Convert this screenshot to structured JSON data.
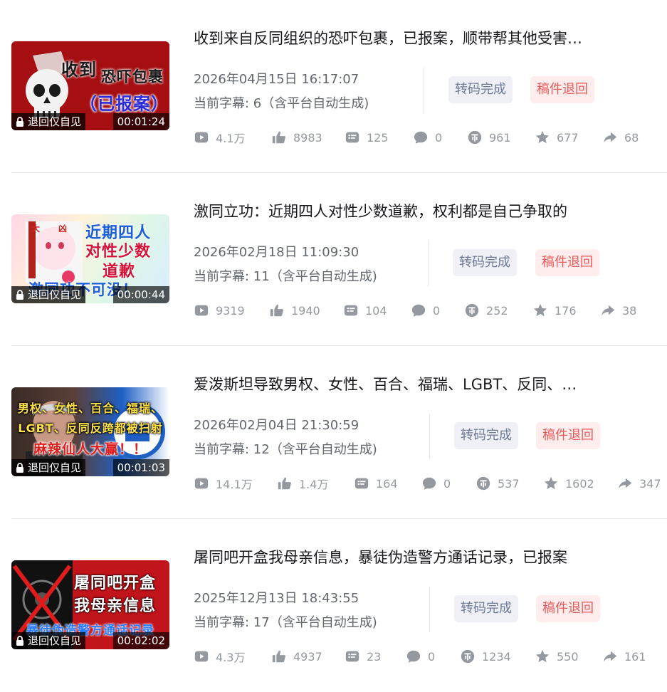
{
  "colors": {
    "stat_icon": "#9499a0",
    "pill_trans_bg": "#eef0f5",
    "pill_reject_bg": "#ffecec",
    "pill_reject_text": "#e85b5b"
  },
  "items": [
    {
      "title": "收到来自反同组织的恐吓包裹，已报案，顺带帮其他受害…",
      "thumb_lines": [
        "收到",
        "恐吓包裹",
        "（已报案）"
      ],
      "badge": "退回仅自见",
      "duration": "00:01:24",
      "date": "2026年04月15日 16:17:07",
      "subtitles": "当前字幕: 6（含平台自动生成)",
      "status_transcode": "转码完成",
      "status_reject": "稿件退回",
      "stats": {
        "plays": "4.1万",
        "likes": "8983",
        "danmaku": "125",
        "comments": "0",
        "coins": "961",
        "favorites": "677",
        "shares": "68"
      }
    },
    {
      "title": "激同立功：近期四人对性少数道歉，权利都是自己争取的",
      "thumb_lines": [
        "近期四人",
        "对性少数",
        "道歉",
        "激同功不可没！"
      ],
      "badge": "退回仅自见",
      "duration": "00:00:44",
      "date": "2026年02月18日 11:09:30",
      "subtitles": "当前字幕: 11（含平台自动生成)",
      "status_transcode": "转码完成",
      "status_reject": "稿件退回",
      "stats": {
        "plays": "9319",
        "likes": "1940",
        "danmaku": "104",
        "comments": "0",
        "coins": "252",
        "favorites": "176",
        "shares": "38"
      }
    },
    {
      "title": "爱泼斯坦导致男权、女性、百合、福瑞、LGBT、反同、…",
      "thumb_lines": [
        "男权、女性、百合、福瑞、",
        "LGBT、反同反跨都被扫射",
        "麻辣仙人大赢！！"
      ],
      "badge": "退回仅自见",
      "duration": "00:01:03",
      "date": "2026年02月04日 21:30:59",
      "subtitles": "当前字幕: 12（含平台自动生成)",
      "status_transcode": "转码完成",
      "status_reject": "稿件退回",
      "stats": {
        "plays": "14.1万",
        "likes": "1.4万",
        "danmaku": "164",
        "comments": "0",
        "coins": "537",
        "favorites": "1602",
        "shares": "347"
      }
    },
    {
      "title": "屠同吧开盒我母亲信息，暴徒伪造警方通话记录，已报案",
      "thumb_lines": [
        "屠同吧开盒",
        "我母亲信息",
        "暴徒伪造警方通话记录"
      ],
      "badge": "退回仅自见",
      "duration": "00:02:02",
      "date": "2025年12月13日 18:43:55",
      "subtitles": "当前字幕: 17（含平台自动生成)",
      "status_transcode": "转码完成",
      "status_reject": "稿件退回",
      "stats": {
        "plays": "4.3万",
        "likes": "4937",
        "danmaku": "23",
        "comments": "0",
        "coins": "1234",
        "favorites": "550",
        "shares": "161"
      }
    }
  ]
}
